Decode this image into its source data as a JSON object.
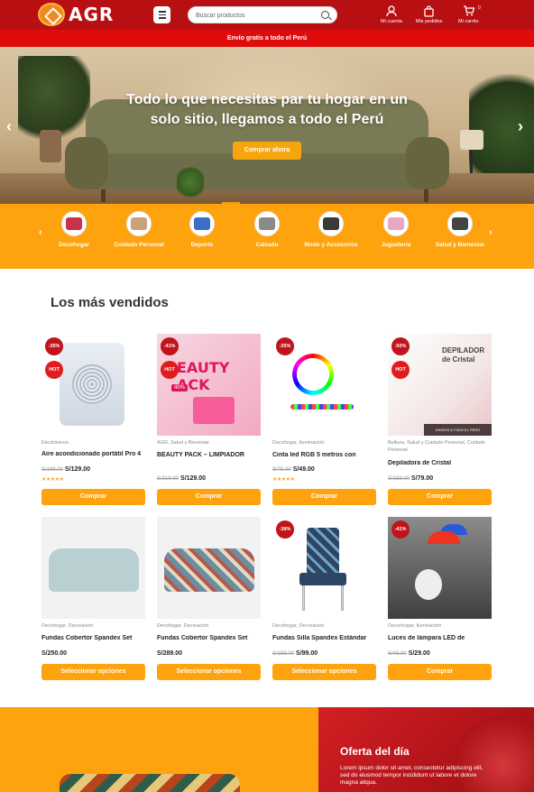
{
  "header": {
    "logo_text": "AGR",
    "search_placeholder": "Buscar productos",
    "account_label": "Mi cuenta",
    "orders_label": "Mis pedidos",
    "cart_label": "Mi carrito",
    "cart_count": "0"
  },
  "promo_bar": "Envío gratis a todo el Perú",
  "hero": {
    "title": "Todo lo que necesitas par tu hogar en un solo sitio, llegamos a todo el Perú",
    "button": "Comprar ahora",
    "prev": "‹",
    "next": "›"
  },
  "categories": {
    "prev": "‹",
    "next": "›",
    "items": [
      {
        "label": "Decohogar",
        "color": "#c8324a"
      },
      {
        "label": "Cuidado Personal",
        "color": "#c9a27a"
      },
      {
        "label": "Deporte",
        "color": "#3b6fc6"
      },
      {
        "label": "Calzado",
        "color": "#8a8a8a"
      },
      {
        "label": "Modo y Accesorios",
        "color": "#3a3a3a"
      },
      {
        "label": "Juguetería",
        "color": "#e8a7c2"
      },
      {
        "label": "Salud y Bienestar",
        "color": "#444444"
      }
    ]
  },
  "best_sellers": {
    "title": "Los más vendidos",
    "products": [
      {
        "discount": "-35%",
        "hot": "HOT",
        "category": "Electrónicos",
        "name": "Aire acondicionado portátil Pro 4",
        "old_price": "S/199.00",
        "price": "S/129.00",
        "stars": "★★★★★",
        "button": "Comprar"
      },
      {
        "discount": "-41%",
        "hot": "HOT",
        "category": "AGR, Salud y Bienestar",
        "name": "BEAUTY PACK – LIMPIADOR",
        "old_price": "S/319.00",
        "price": "S/129.00",
        "button": "Comprar"
      },
      {
        "discount": "-35%",
        "category": "Decohogar, Iluminación",
        "name": "Cinta led RGB 5 metros con",
        "old_price": "S/75.00",
        "price": "S/49.00",
        "stars": "★★★★★",
        "button": "Comprar"
      },
      {
        "discount": "-50%",
        "hot": "HOT",
        "category": "Belleza, Salud y Cuidado Personal, Cuidado Personal",
        "name": "Depiladora de Cristal",
        "old_price": "S/159.00",
        "price": "S/79.00",
        "button": "Comprar"
      },
      {
        "category": "Decohogar, Decoración",
        "name": "Fundas Cobertor Spandex Set",
        "price": "S/250.00",
        "button": "Seleccionar opciones"
      },
      {
        "category": "Decohogar, Decoración",
        "name": "Fundas Cobertor Spandex Set",
        "price": "S/289.00",
        "button": "Seleccionar opciones"
      },
      {
        "discount": "-38%",
        "category": "Decohogar, Decoración",
        "name": "Fundas Silla Spandex Estándar",
        "old_price": "S/159.00",
        "price": "S/99.00",
        "button": "Seleccionar opciones"
      },
      {
        "discount": "-41%",
        "category": "Decorhogar, Iluminación",
        "name": "Luces de lámpara LED de",
        "old_price": "S/49.00",
        "price": "S/29.00",
        "button": "Comprar"
      }
    ],
    "image_text": {
      "beauty_badge": "40%",
      "beauty_word": "EAUTY ACK",
      "depil_word": "DEPILADOR de Cristal",
      "depil_band": "ENVÍOS A TODO EL PERÚ"
    }
  },
  "deal": {
    "title": "Oferta del día",
    "text": "Lorem ipsum dolor sit amet, consectetur adipiscing elit, sed do eiusmod tempor incididunt ut labore et dolore magna aliqua."
  }
}
